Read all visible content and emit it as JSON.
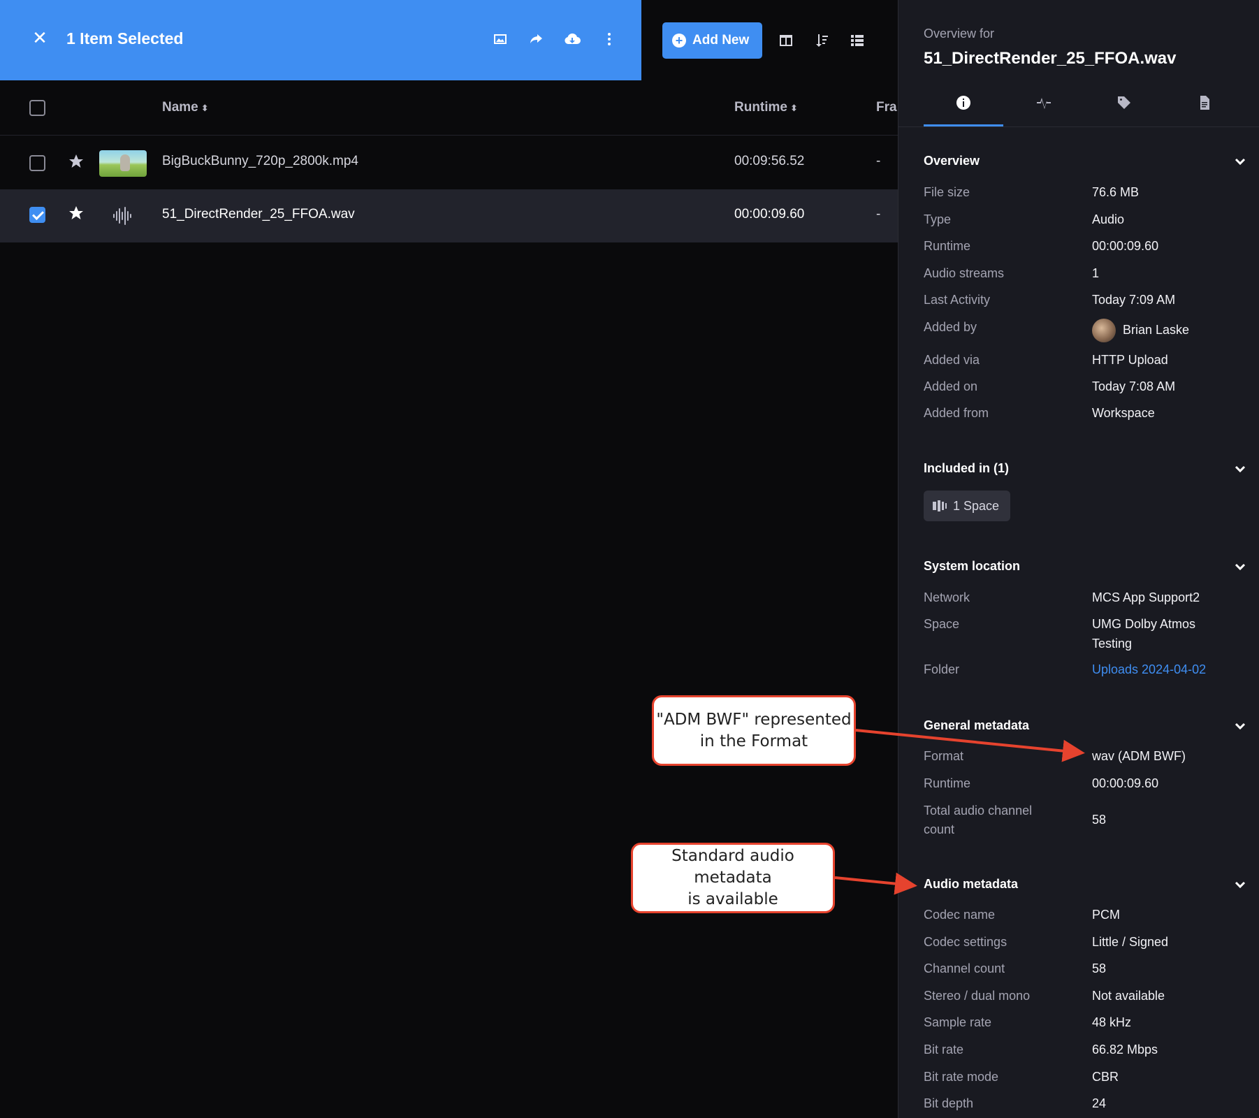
{
  "selection_bar": {
    "title": "1 Item Selected",
    "color": "#3f8ef2",
    "icons": [
      "close-icon",
      "image-icon",
      "share-icon",
      "cloud-download-icon",
      "more-vertical-icon"
    ]
  },
  "toolbar": {
    "add_new_label": "Add New",
    "icons": [
      "split-view-icon",
      "sort-icon",
      "list-view-icon"
    ]
  },
  "table": {
    "columns": {
      "name": "Name",
      "runtime": "Runtime",
      "frame": "Fra"
    },
    "rows": [
      {
        "name": "BigBuckBunny_720p_2800k.mp4",
        "runtime": "00:09:56.52",
        "frame": "-",
        "selected": false,
        "thumbnail": "video-thumbnail"
      },
      {
        "name": "51_DirectRender_25_FFOA.wav",
        "runtime": "00:00:09.60",
        "frame": "-",
        "selected": true,
        "thumbnail": "audio-waveform-icon"
      }
    ]
  },
  "panel": {
    "overview_for": "Overview for",
    "filename": "51_DirectRender_25_FFOA.wav",
    "tabs": [
      "info-icon",
      "waveform-icon",
      "tag-icon",
      "document-icon"
    ],
    "overview": {
      "title": "Overview",
      "rows": [
        {
          "label": "File size",
          "value": "76.6 MB"
        },
        {
          "label": "Type",
          "value": "Audio"
        },
        {
          "label": "Runtime",
          "value": "00:00:09.60"
        },
        {
          "label": "Audio streams",
          "value": "1"
        },
        {
          "label": "Last Activity",
          "value": "Today 7:09 AM"
        },
        {
          "label": "Added by",
          "value": "Brian Laske"
        },
        {
          "label": "Added via",
          "value": "HTTP Upload"
        },
        {
          "label": "Added on",
          "value": "Today 7:08 AM"
        },
        {
          "label": "Added from",
          "value": "Workspace"
        }
      ]
    },
    "included": {
      "title": "Included in (1)",
      "chip": "1 Space"
    },
    "system_location": {
      "title": "System location",
      "network_label": "Network",
      "network": "MCS App Support2",
      "space_label": "Space",
      "space_line1": "UMG Dolby Atmos",
      "space_line2": "Testing",
      "folder_label": "Folder",
      "folder": "Uploads 2024-04-02"
    },
    "general_metadata": {
      "title": "General metadata",
      "format_label": "Format",
      "format": "wav (ADM BWF)",
      "runtime_label": "Runtime",
      "runtime": "00:00:09.60",
      "channels_label_line1": "Total audio channel",
      "channels_label_line2": "count",
      "channels": "58"
    },
    "audio_metadata": {
      "title": "Audio metadata",
      "rows": [
        {
          "label": "Codec name",
          "value": "PCM"
        },
        {
          "label": "Codec settings",
          "value": "Little / Signed"
        },
        {
          "label": "Channel count",
          "value": "58"
        },
        {
          "label": "Stereo / dual mono",
          "value": "Not available"
        },
        {
          "label": "Sample rate",
          "value": "48 kHz"
        },
        {
          "label": "Bit rate",
          "value": "66.82 Mbps"
        },
        {
          "label": "Bit rate mode",
          "value": "CBR"
        },
        {
          "label": "Bit depth",
          "value": "24"
        }
      ]
    }
  },
  "callouts": {
    "format_line1": "\"ADM BWF\" represented",
    "format_line2": "in the Format",
    "audio_line1": "Standard audio metadata",
    "audio_line2": "is available",
    "border_color": "#e6432e"
  }
}
